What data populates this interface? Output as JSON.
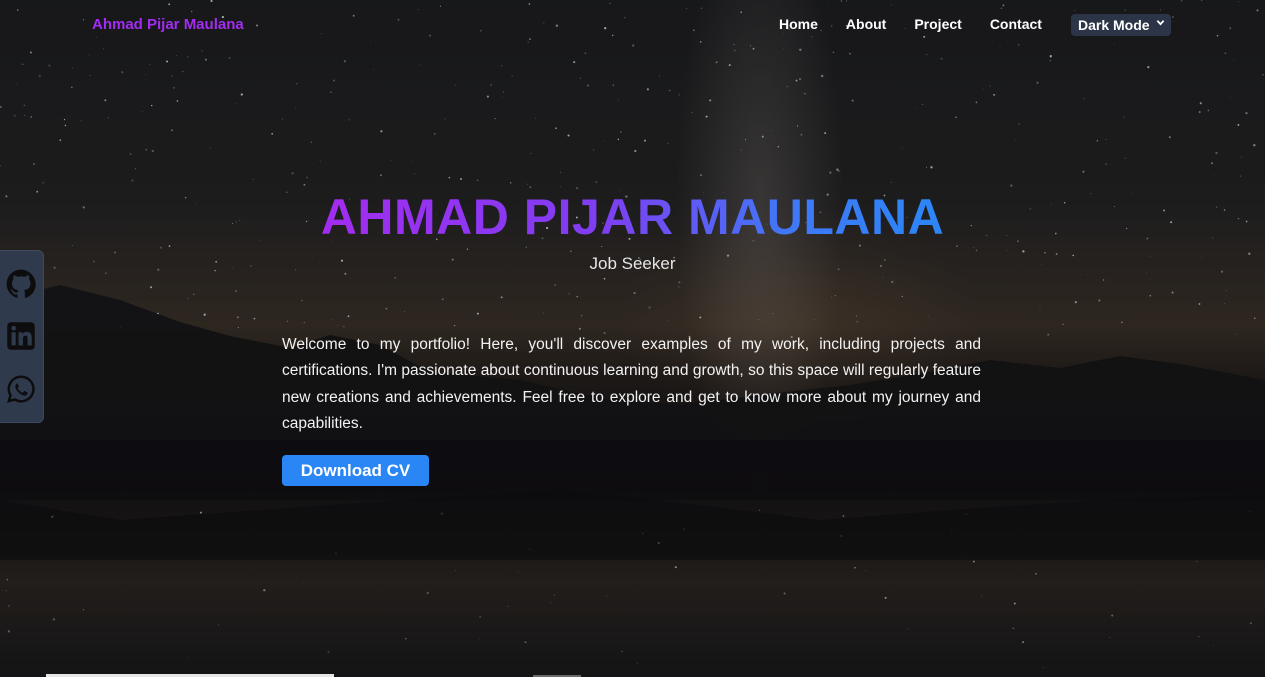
{
  "navbar": {
    "brand": "Ahmad Pijar Maulana",
    "links": [
      {
        "label": "Home"
      },
      {
        "label": "About"
      },
      {
        "label": "Project"
      },
      {
        "label": "Contact"
      }
    ],
    "theme_select": {
      "selected": "Dark Mode",
      "icon": "chevron-down-icon"
    }
  },
  "social": [
    {
      "name": "github",
      "icon": "github-icon"
    },
    {
      "name": "linkedin",
      "icon": "linkedin-icon"
    },
    {
      "name": "whatsapp",
      "icon": "whatsapp-icon"
    }
  ],
  "hero": {
    "title": "AHMAD PIJAR MAULANA",
    "subtitle": "Job Seeker",
    "description": "Welcome to my portfolio! Here, you'll discover examples of my work, including projects and certifications. I'm passionate about continuous learning and growth, so this space will regularly feature new creations and achievements. Feel free to explore and get to know more about my journey and capabilities.",
    "cta_label": "Download CV"
  },
  "colors": {
    "brand": "#a22cf0",
    "gradient_start": "#a22cf0",
    "gradient_end": "#2c86f7",
    "button": "#2b86f5",
    "social_bar": "#2f3a4d"
  }
}
